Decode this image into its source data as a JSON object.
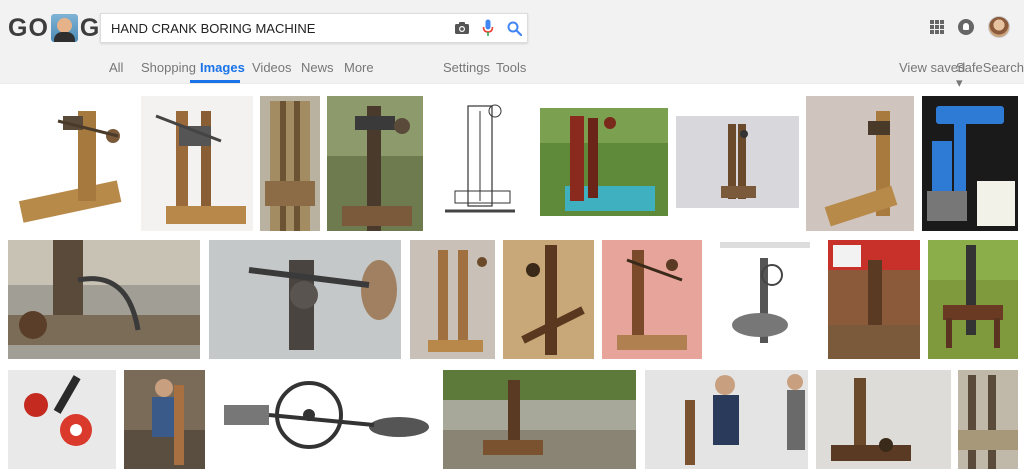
{
  "logo": {
    "text_left": "GO",
    "text_right": "GLE"
  },
  "search": {
    "query": "HAND CRANK BORING MACHINE"
  },
  "icons": {
    "camera": "camera-icon",
    "mic": "microphone-icon",
    "search": "search-icon",
    "apps": "apps-grid-icon",
    "notifications": "notifications-icon",
    "avatar": "account-avatar"
  },
  "tabs": {
    "all": "All",
    "shopping": "Shopping",
    "images": "Images",
    "videos": "Videos",
    "news": "News",
    "more": "More",
    "settings": "Settings",
    "tools": "Tools",
    "view_saved": "View saved",
    "safesearch": "SafeSearch ▾"
  },
  "colors": {
    "accent": "#1a73e8",
    "header_bg": "#f2f2f2"
  },
  "results": [
    {
      "label": "boring-machine-wood-1"
    },
    {
      "label": "boring-machine-wood-2"
    },
    {
      "label": "boring-machine-wood-3"
    },
    {
      "label": "boring-machine-outdoor-1"
    },
    {
      "label": "boring-machine-drawing"
    },
    {
      "label": "boring-machine-red-grass"
    },
    {
      "label": "boring-machine-small"
    },
    {
      "label": "boring-machine-wood-4"
    },
    {
      "label": "drill-press-blue"
    },
    {
      "label": "boring-machine-closeup-1"
    },
    {
      "label": "boring-machine-closeup-2"
    },
    {
      "label": "boring-machine-wood-5"
    },
    {
      "label": "boring-machine-wood-6"
    },
    {
      "label": "boring-machine-pink"
    },
    {
      "label": "drilling-machine-illustration"
    },
    {
      "label": "boring-machine-busch"
    },
    {
      "label": "boring-machine-bench"
    },
    {
      "label": "hand-drill-red"
    },
    {
      "label": "boring-machine-man"
    },
    {
      "label": "hand-drill-drawing"
    },
    {
      "label": "boring-machine-plants"
    },
    {
      "label": "boring-machine-demo"
    },
    {
      "label": "boring-machine-interior"
    },
    {
      "label": "boring-machine-partial"
    }
  ]
}
